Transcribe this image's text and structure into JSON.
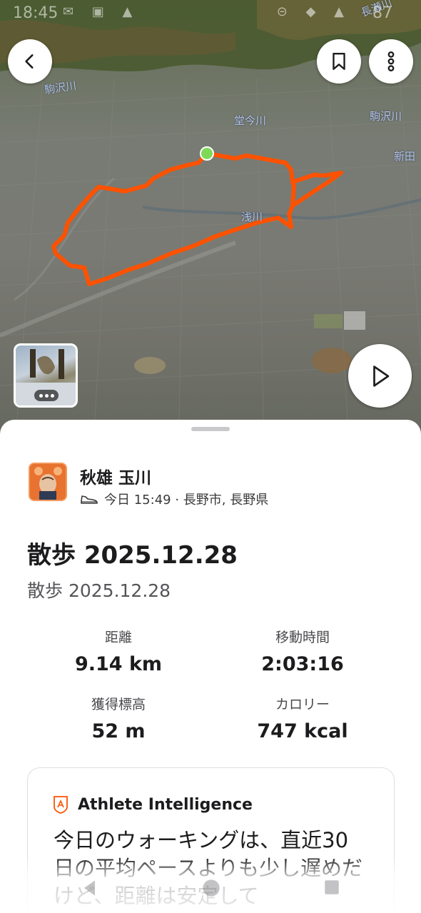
{
  "status_bar": {
    "time": "18:45",
    "battery": "87"
  },
  "map": {
    "labels": [
      "駒沢川",
      "堂今川",
      "駒沢川",
      "新田",
      "浅川",
      "長瀬川"
    ],
    "route_color": "#fc5200",
    "start_marker_color": "#7ed957"
  },
  "icons": {
    "back": "chevron-left-icon",
    "bookmark": "bookmark-icon",
    "more": "more-vertical-icon",
    "play": "play-icon",
    "shoe": "shoe-icon",
    "ai": "athlete-intelligence-icon"
  },
  "athlete": {
    "name": "秋雄 玉川",
    "meta": "今日 15:49 · 長野市, 長野県"
  },
  "activity": {
    "title": "散歩 2025.12.28",
    "description": "散歩 2025.12.28"
  },
  "stats": {
    "distance_label": "距離",
    "distance_value": "9.14 km",
    "moving_time_label": "移動時間",
    "moving_time_value": "2:03:16",
    "elevation_label": "獲得標高",
    "elevation_value": "52 m",
    "calories_label": "カロリー",
    "calories_value": "747 kcal"
  },
  "athlete_intelligence": {
    "title": "Athlete Intelligence",
    "text": "今日のウォーキングは、直近30日の平均ペースよりも少し遅めだけど、距離は安定して"
  },
  "colors": {
    "accent": "#fc5200",
    "text_primary": "#1c1c1e",
    "text_secondary": "#555559"
  }
}
